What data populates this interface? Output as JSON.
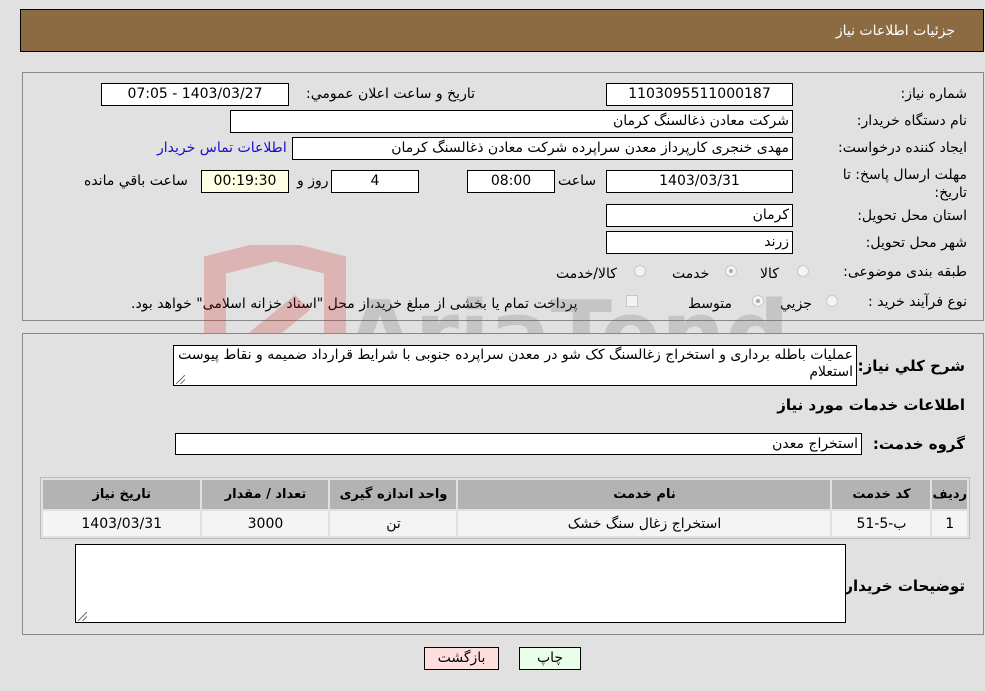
{
  "header": {
    "title": "جزئیات اطلاعات نیاز"
  },
  "form": {
    "need_number": {
      "label": "شماره نیاز:",
      "value": "1103095511000187"
    },
    "announce_datetime": {
      "label": "تاریخ و ساعت اعلان عمومي:",
      "value": "1403/03/27 - 07:05"
    },
    "buyer_org": {
      "label": "نام دستگاه خریدار:",
      "value": "شرکت معادن ذغالسنگ کرمان"
    },
    "requester": {
      "label": "ایجاد کننده درخواست:",
      "value": "مهدی خنجری کارپرداز معدن سراپرده  شرکت معادن ذغالسنگ کرمان"
    },
    "buyer_contact_link": "اطلاعات تماس خریدار",
    "deadline": {
      "label": "مهلت ارسال پاسخ: تا تاریخ:",
      "date": "1403/03/31",
      "time_label": "ساعت",
      "time": "08:00",
      "days": "4",
      "days_label": "روز و",
      "remaining": "00:19:30",
      "remaining_label": "ساعت باقي مانده"
    },
    "delivery_province": {
      "label": "استان محل تحویل:",
      "value": "کرمان"
    },
    "delivery_city": {
      "label": "شهر محل تحویل:",
      "value": "زرند"
    },
    "category": {
      "label": "طبقه بندی موضوعی:",
      "options": [
        "کالا",
        "خدمت",
        "کالا/خدمت"
      ],
      "selected": "خدمت"
    },
    "purchase_type": {
      "label": "نوع فرآیند خرید :",
      "options": [
        "جزيي",
        "متوسط"
      ],
      "selected": "متوسط",
      "treasury_note": "پرداخت تمام یا بخشی از مبلغ خرید،از محل \"اسناد خزانه اسلامی\" خواهد بود."
    }
  },
  "description": {
    "label": "شرح کلي نیاز:",
    "value": "عملیات باطله برداری و استخراج زغالسنگ کک شو در معدن سراپرده جنوبی با شرایط قرارداد ضمیمه و نقاط پیوست استعلام"
  },
  "services_section": {
    "title": "اطلاعات خدمات مورد نیاز",
    "group_label": "گروه خدمت:",
    "group_value": "استخراج معدن"
  },
  "table": {
    "columns": [
      "ردیف",
      "کد خدمت",
      "نام خدمت",
      "واحد اندازه گیری",
      "تعداد / مقدار",
      "تاریخ نیاز"
    ],
    "rows": [
      [
        "1",
        "ب-5-51",
        "استخراج زغال سنگ خشک",
        "تن",
        "3000",
        "1403/03/31"
      ]
    ]
  },
  "buyer_notes": {
    "label": "توضیحات خریدار:",
    "value": ""
  },
  "buttons": {
    "print": "چاپ",
    "back": "بازگشت"
  },
  "watermark": "AriaTender.neT"
}
